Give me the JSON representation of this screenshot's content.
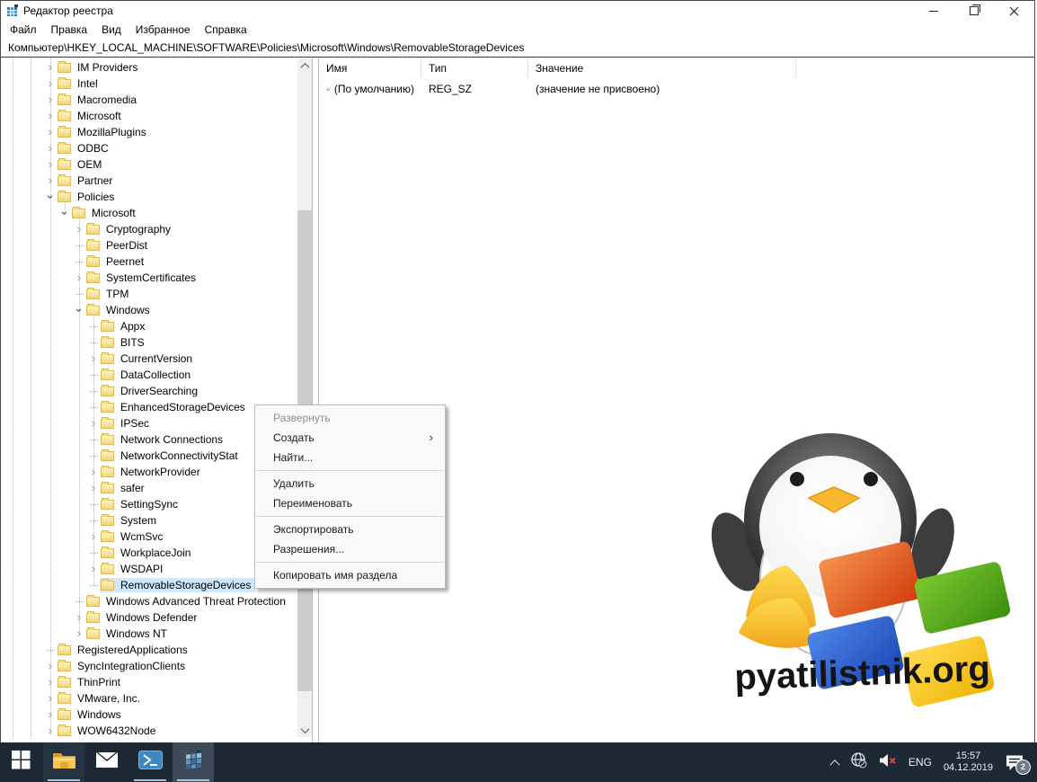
{
  "window": {
    "title": "Редактор реестра",
    "icon": "registry-icon",
    "controls": {
      "minimize": "minimize-icon",
      "restore": "restore-icon",
      "close": "close-icon"
    }
  },
  "menu_bar": {
    "items": [
      "Файл",
      "Правка",
      "Вид",
      "Избранное",
      "Справка"
    ]
  },
  "address_bar": {
    "path": "Компьютер\\HKEY_LOCAL_MACHINE\\SOFTWARE\\Policies\\Microsoft\\Windows\\RemovableStorageDevices"
  },
  "tree": {
    "items": [
      {
        "label": "IM Providers",
        "level": 1,
        "state": "collapsed"
      },
      {
        "label": "Intel",
        "level": 1,
        "state": "collapsed"
      },
      {
        "label": "Macromedia",
        "level": 1,
        "state": "collapsed"
      },
      {
        "label": "Microsoft",
        "level": 1,
        "state": "collapsed"
      },
      {
        "label": "MozillaPlugins",
        "level": 1,
        "state": "collapsed"
      },
      {
        "label": "ODBC",
        "level": 1,
        "state": "collapsed"
      },
      {
        "label": "OEM",
        "level": 1,
        "state": "collapsed"
      },
      {
        "label": "Partner",
        "level": 1,
        "state": "collapsed"
      },
      {
        "label": "Policies",
        "level": 1,
        "state": "expanded"
      },
      {
        "label": "Microsoft",
        "level": 2,
        "state": "expanded"
      },
      {
        "label": "Cryptography",
        "level": 3,
        "state": "collapsed"
      },
      {
        "label": "PeerDist",
        "level": 3,
        "state": "leaf"
      },
      {
        "label": "Peernet",
        "level": 3,
        "state": "leaf"
      },
      {
        "label": "SystemCertificates",
        "level": 3,
        "state": "collapsed"
      },
      {
        "label": "TPM",
        "level": 3,
        "state": "leaf"
      },
      {
        "label": "Windows",
        "level": 3,
        "state": "expanded"
      },
      {
        "label": "Appx",
        "level": 4,
        "state": "leaf"
      },
      {
        "label": "BITS",
        "level": 4,
        "state": "leaf"
      },
      {
        "label": "CurrentVersion",
        "level": 4,
        "state": "collapsed"
      },
      {
        "label": "DataCollection",
        "level": 4,
        "state": "leaf"
      },
      {
        "label": "DriverSearching",
        "level": 4,
        "state": "leaf"
      },
      {
        "label": "EnhancedStorageDevices",
        "level": 4,
        "state": "leaf"
      },
      {
        "label": "IPSec",
        "level": 4,
        "state": "collapsed"
      },
      {
        "label": "Network Connections",
        "level": 4,
        "state": "leaf"
      },
      {
        "label": "NetworkConnectivityStat",
        "level": 4,
        "state": "leaf"
      },
      {
        "label": "NetworkProvider",
        "level": 4,
        "state": "collapsed"
      },
      {
        "label": "safer",
        "level": 4,
        "state": "collapsed"
      },
      {
        "label": "SettingSync",
        "level": 4,
        "state": "leaf"
      },
      {
        "label": "System",
        "level": 4,
        "state": "leaf"
      },
      {
        "label": "WcmSvc",
        "level": 4,
        "state": "collapsed"
      },
      {
        "label": "WorkplaceJoin",
        "level": 4,
        "state": "leaf"
      },
      {
        "label": "WSDAPI",
        "level": 4,
        "state": "collapsed"
      },
      {
        "label": "RemovableStorageDevices",
        "level": 4,
        "state": "leaf",
        "selected": true
      },
      {
        "label": "Windows Advanced Threat Protection",
        "level": 3,
        "state": "leaf"
      },
      {
        "label": "Windows Defender",
        "level": 3,
        "state": "collapsed"
      },
      {
        "label": "Windows NT",
        "level": 3,
        "state": "collapsed"
      },
      {
        "label": "RegisteredApplications",
        "level": 1,
        "state": "leaf"
      },
      {
        "label": "SyncIntegrationClients",
        "level": 1,
        "state": "collapsed"
      },
      {
        "label": "ThinPrint",
        "level": 1,
        "state": "collapsed"
      },
      {
        "label": "VMware, Inc.",
        "level": 1,
        "state": "collapsed"
      },
      {
        "label": "Windows",
        "level": 1,
        "state": "collapsed"
      },
      {
        "label": "WOW6432Node",
        "level": 1,
        "state": "collapsed"
      }
    ]
  },
  "list": {
    "columns": [
      "Имя",
      "Тип",
      "Значение"
    ],
    "rows": [
      {
        "icon": "string-value-icon",
        "name": "(По умолчанию)",
        "type": "REG_SZ",
        "value": "(значение не присвоено)"
      }
    ]
  },
  "context_menu": {
    "items": [
      {
        "label": "Развернуть",
        "disabled": true
      },
      {
        "label": "Создать",
        "submenu": true
      },
      {
        "label": "Найти..."
      },
      {
        "type": "separator"
      },
      {
        "label": "Удалить"
      },
      {
        "label": "Переименовать"
      },
      {
        "type": "separator"
      },
      {
        "label": "Экспортировать"
      },
      {
        "label": "Разрешения..."
      },
      {
        "type": "separator"
      },
      {
        "label": "Копировать имя раздела"
      }
    ]
  },
  "watermark": {
    "text": "pyatilistnik.org"
  },
  "taskbar": {
    "apps": [
      {
        "name": "start-button",
        "icon": "windows-start-icon",
        "open": false,
        "active": false
      },
      {
        "name": "file-explorer-button",
        "icon": "file-explorer-icon",
        "open": true,
        "active": false,
        "bg": true
      },
      {
        "name": "mail-button",
        "icon": "mail-icon",
        "open": false,
        "active": false
      },
      {
        "name": "powershell-button",
        "icon": "powershell-icon",
        "open": true,
        "active": false
      },
      {
        "name": "registry-editor-button",
        "icon": "registry-editor-icon",
        "open": true,
        "active": true
      }
    ],
    "tray": {
      "language": "ENG",
      "time": "15:57",
      "date": "04.12.2019",
      "notification_count": "2",
      "icons": [
        "chevron-up-icon",
        "network-globe-icon",
        "volume-muted-icon",
        "notification-icon"
      ]
    }
  },
  "colors": {
    "selection": "#cce8ff",
    "taskbar": "#1d2935",
    "underline_accent": "#9ac6e8"
  }
}
